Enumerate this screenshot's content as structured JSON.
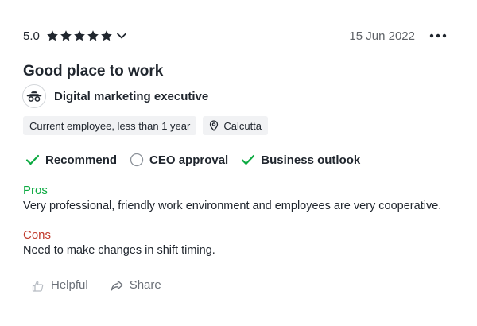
{
  "review": {
    "rating": "5.0",
    "rating_value": 5,
    "rating_max": 5,
    "date": "15 Jun 2022",
    "title": "Good place to work",
    "job_title": "Digital marketing executive",
    "tags": {
      "employment": "Current employee, less than 1 year",
      "location": "Calcutta"
    },
    "indicators": {
      "recommend": {
        "label": "Recommend",
        "status": "positive"
      },
      "ceo_approval": {
        "label": "CEO approval",
        "status": "neutral"
      },
      "business_outlook": {
        "label": "Business outlook",
        "status": "positive"
      }
    },
    "pros_label": "Pros",
    "pros_text": "Very professional, friendly work environment and employees are very cooperative.",
    "cons_label": "Cons",
    "cons_text": "Need to make changes in shift timing.",
    "actions": {
      "helpful": "Helpful",
      "share": "Share"
    }
  },
  "colors": {
    "text": "#20262e",
    "muted": "#5f6368",
    "positive": "#0caa41",
    "negative": "#c0392b",
    "chip_bg": "#f1f2f4"
  },
  "icons": [
    "star-icon",
    "chevron-down-icon",
    "more-options-icon",
    "job-briefcase-icon",
    "location-pin-icon",
    "checkmark-icon",
    "circle-neutral-icon",
    "helpful-hand-icon",
    "share-icon"
  ]
}
